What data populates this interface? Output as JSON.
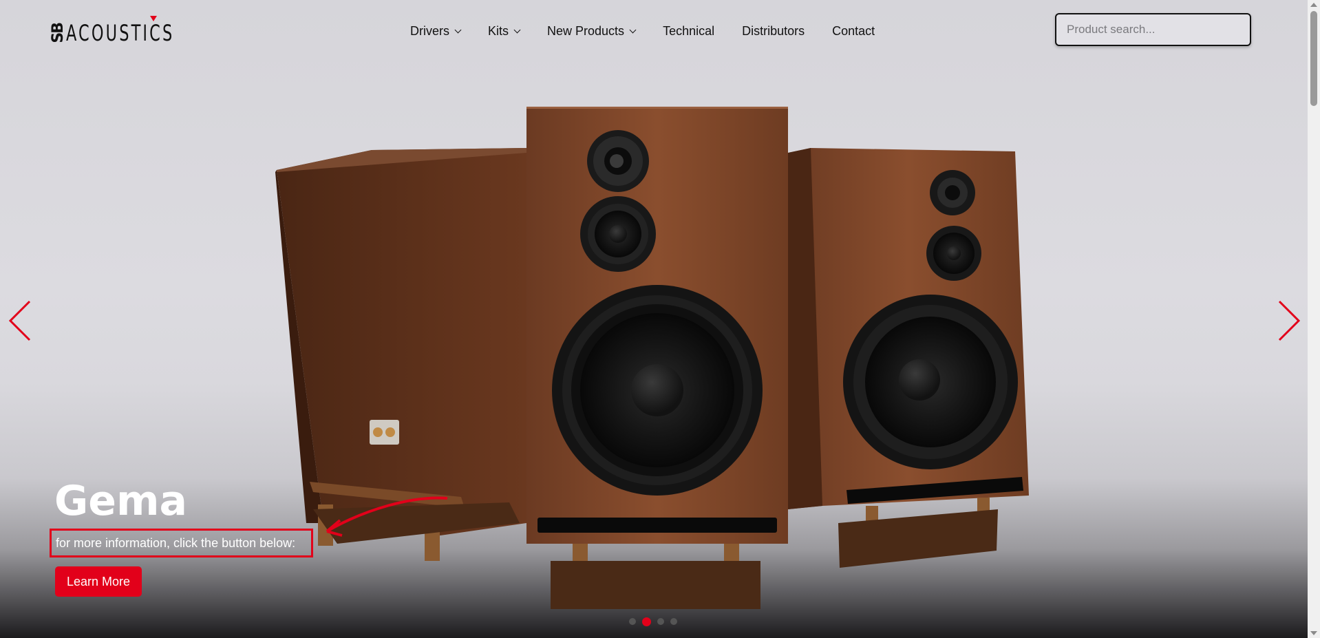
{
  "header": {
    "logo_prefix": "SB",
    "logo_word": "ACOUSTICS",
    "brand_color": "#e2001a"
  },
  "nav": {
    "items": [
      {
        "label": "Drivers",
        "has_dropdown": true
      },
      {
        "label": "Kits",
        "has_dropdown": true
      },
      {
        "label": "New Products",
        "has_dropdown": true
      },
      {
        "label": "Technical",
        "has_dropdown": false
      },
      {
        "label": "Distributors",
        "has_dropdown": false
      },
      {
        "label": "Contact",
        "has_dropdown": false
      }
    ]
  },
  "search": {
    "placeholder": "Product search...",
    "value": ""
  },
  "hero": {
    "title": "Gema",
    "caption": "for more information, click the button below:",
    "button_label": "Learn More",
    "slide_count": 4,
    "active_slide": 2,
    "prev_icon": "chevron-left-icon",
    "next_icon": "chevron-right-icon"
  }
}
